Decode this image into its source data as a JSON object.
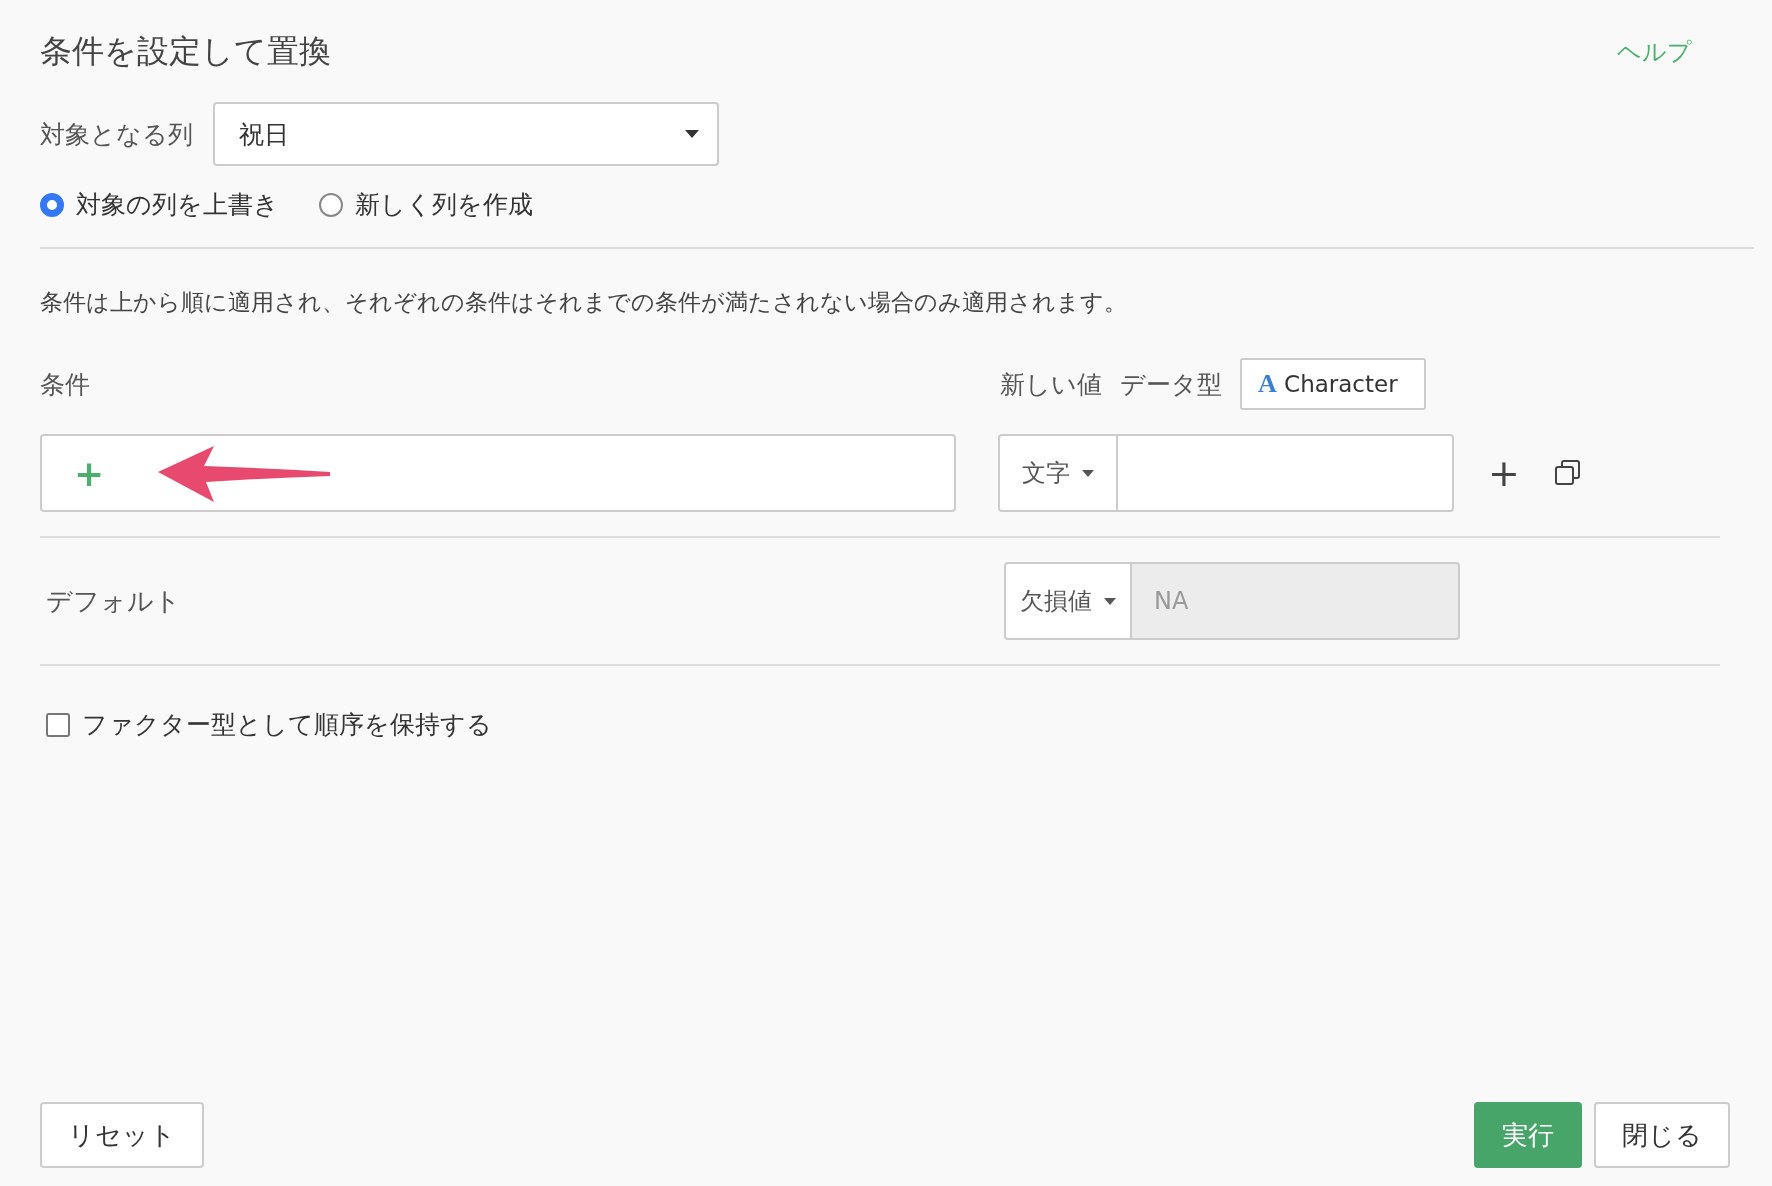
{
  "title": "条件を設定して置換",
  "help_link": "ヘルプ",
  "target_column": {
    "label": "対象となる列",
    "value": "祝日"
  },
  "output_mode": [
    {
      "label": "対象の列を上書き",
      "selected": true
    },
    {
      "label": "新しく列を作成",
      "selected": false
    }
  ],
  "description": "条件は上から順に適用され、それぞれの条件はそれまでの条件が満たされない場合のみ適用されます。",
  "conditions_header": {
    "condition_label": "条件",
    "new_value_label": "新しい値",
    "data_type_label": "データ型",
    "data_type_icon": "A",
    "data_type": "Character"
  },
  "condition_row": {
    "add_icon": "+",
    "value_type": "文字",
    "add_row_icon": "+"
  },
  "default_row": {
    "label": "デフォルト",
    "value_type": "欠損値",
    "value": "NA",
    "disabled": true
  },
  "keep_factor_order": {
    "label": "ファクター型として順序を保持する",
    "checked": false
  },
  "buttons": [
    {
      "label": "リセット",
      "kind": "plain"
    },
    {
      "label": "実行",
      "kind": "primary"
    },
    {
      "label": "閉じる",
      "kind": "plain"
    }
  ]
}
